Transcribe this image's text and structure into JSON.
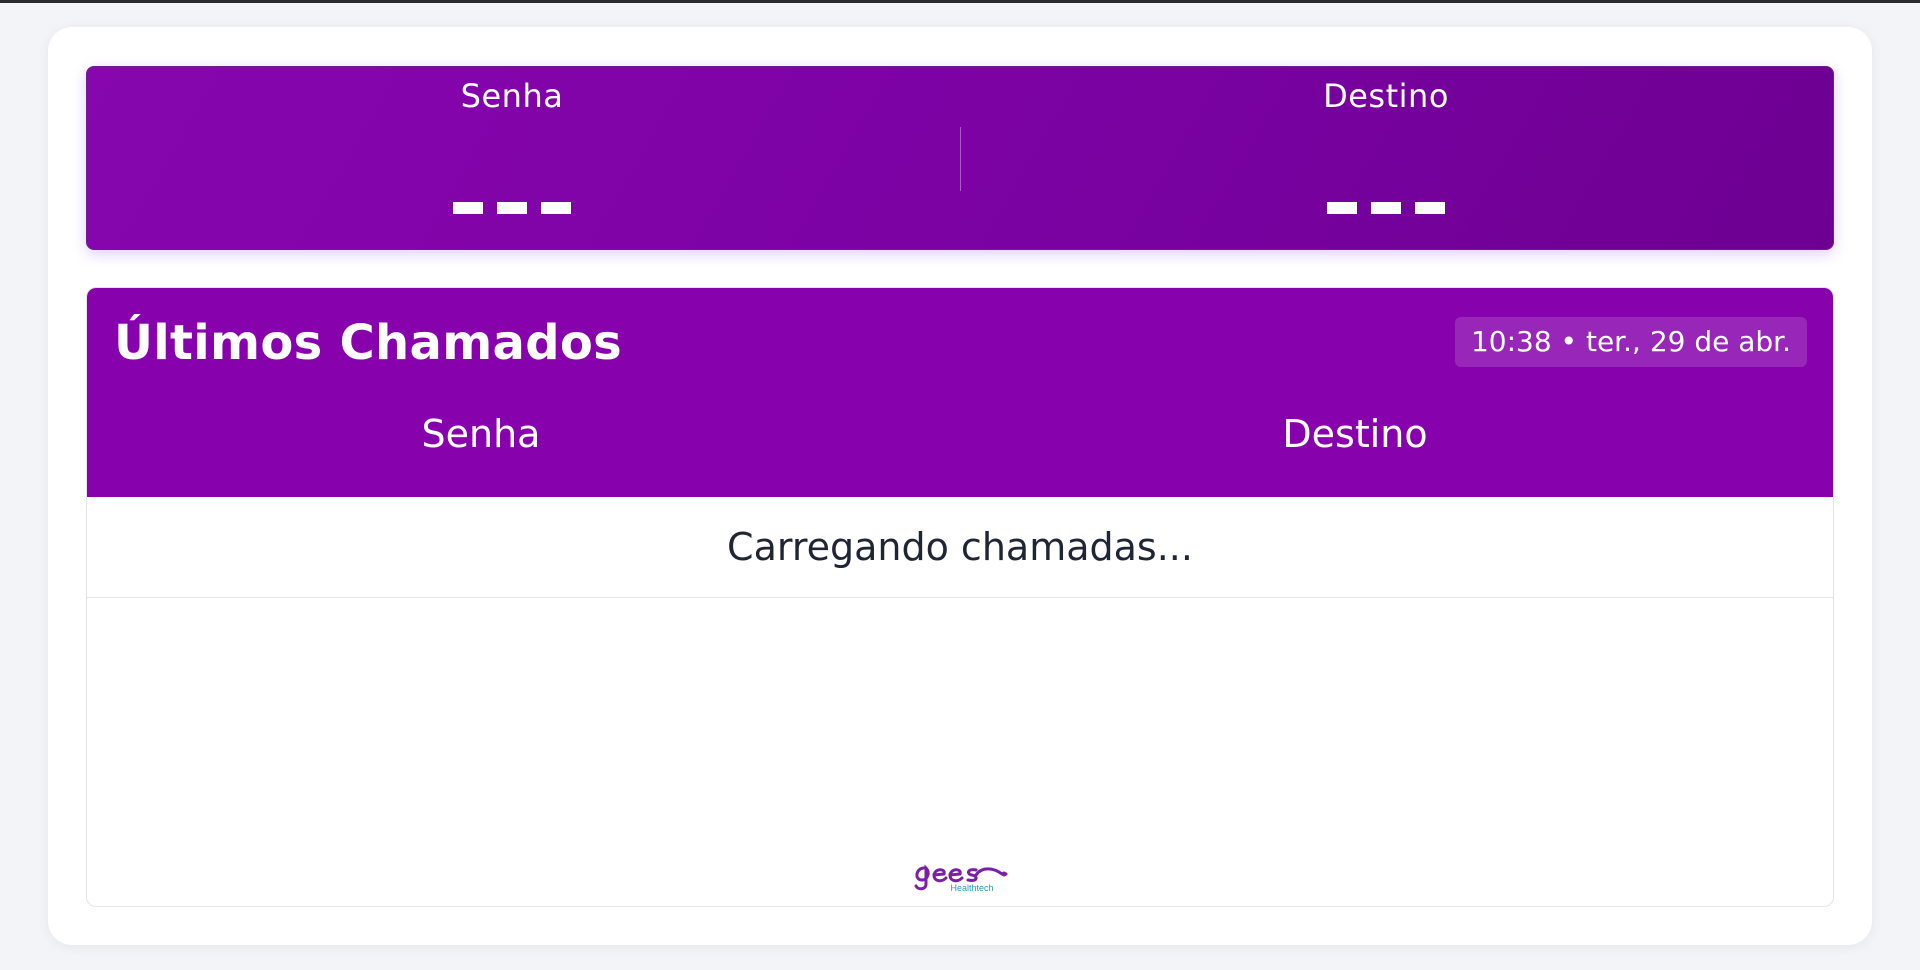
{
  "current": {
    "senha_label": "Senha",
    "senha_value": "---",
    "destino_label": "Destino",
    "destino_value": "---"
  },
  "list": {
    "title": "Últimos Chamados",
    "datetime": "10:38 • ter., 29 de abr.",
    "col_senha": "Senha",
    "col_destino": "Destino",
    "loading_text": "Carregando chamadas..."
  },
  "logo": {
    "icon": "gees-healthtech-logo",
    "text": "gees",
    "subtext": "Healthtech"
  },
  "colors": {
    "primary_purple": "#8701ad",
    "logo_purple": "#7a1fa8",
    "logo_teal": "#2a9ab5"
  }
}
